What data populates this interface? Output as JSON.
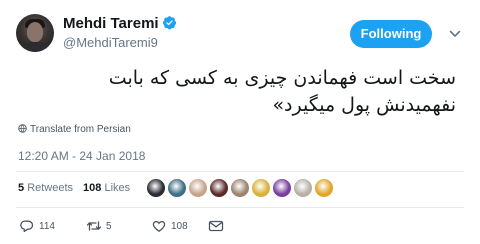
{
  "tweet": {
    "author": {
      "display_name": "Mehdi Taremi",
      "handle": "@MehdiTaremi9",
      "verified": true
    },
    "follow_button_label": "Following",
    "text_line_1": "سخت است فهماندن چیزی به کسی که بابت",
    "text_line_2": "نفهمیدنش پول میگیرد»",
    "translate_label": "Translate from Persian",
    "timestamp": "12:20 AM - 24 Jan 2018",
    "stats": {
      "retweets_count": "5",
      "retweets_label": "Retweets",
      "likes_count": "108",
      "likes_label": "Likes"
    },
    "liker_avatars": [
      {
        "color": "#2a2c33"
      },
      {
        "color": "#3f6e86"
      },
      {
        "color": "#c6a48a"
      },
      {
        "color": "#5b2b2b"
      },
      {
        "color": "#9c8470"
      },
      {
        "color": "#d9b23a"
      },
      {
        "color": "#7a3fa0"
      },
      {
        "color": "#b8b0a8"
      },
      {
        "color": "#e0a62a"
      }
    ],
    "actions": {
      "reply_count": "114",
      "retweet_count": "5",
      "like_count": "108"
    },
    "colors": {
      "accent": "#1da1f2",
      "muted": "#657786"
    },
    "icons": [
      "verified-icon",
      "caret-down-icon",
      "globe-icon",
      "reply-icon",
      "retweet-icon",
      "like-icon",
      "message-icon"
    ]
  }
}
